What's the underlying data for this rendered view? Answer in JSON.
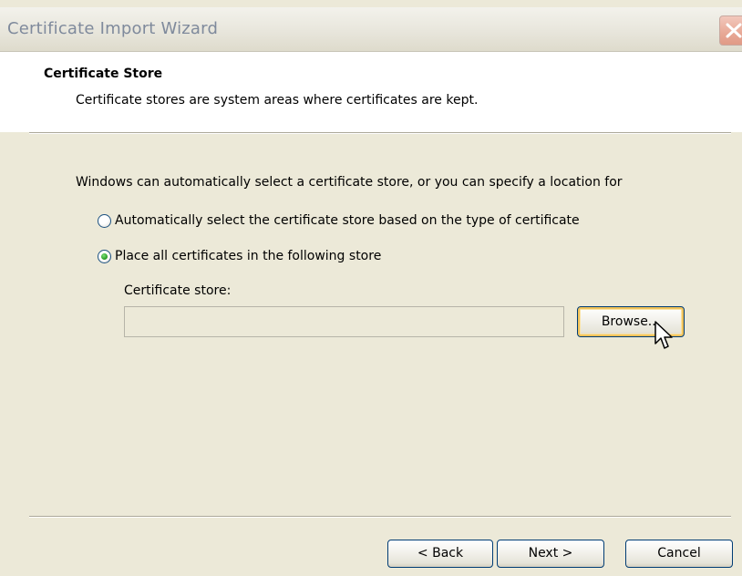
{
  "window": {
    "title": "Certificate Import Wizard",
    "close_icon": "close-icon"
  },
  "header": {
    "title": "Certificate Store",
    "subtitle": "Certificate stores are system areas where certificates are kept."
  },
  "body": {
    "intro": "Windows can automatically select a certificate store, or you can specify a location for",
    "options": [
      {
        "label": "Automatically select the certificate store based on the type of certificate",
        "selected": false
      },
      {
        "label": "Place all certificates in the following store",
        "selected": true
      }
    ],
    "store_label": "Certificate store:",
    "store_value": "",
    "browse_label": "Browse..."
  },
  "footer": {
    "back_label": "< Back",
    "next_label": "Next >",
    "cancel_label": "Cancel"
  },
  "colors": {
    "dialog_background": "#ece9d8",
    "header_background": "#ffffff",
    "title_text": "#7f8a9c",
    "close_button": "#e8a896",
    "button_border": "#003c74",
    "focus_highlight": "#f0c25a",
    "radio_selected_dot": "#2ea32b"
  }
}
